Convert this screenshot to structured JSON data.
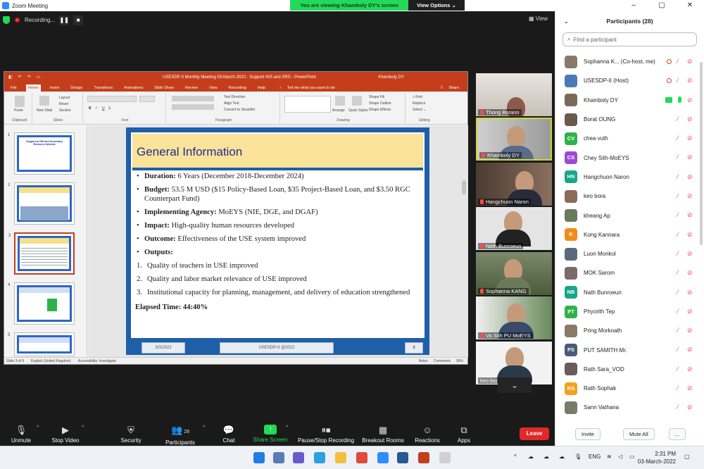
{
  "window": {
    "title": "Zoom Meeting",
    "viewing": "You are viewing Khamboly DY's screen",
    "view_options": "View Options",
    "recording": "Recording...",
    "view": "View"
  },
  "ppt": {
    "doc_title": "USESDP-II Monthly Meeting 03-March-2022 - Support NIS and SRS  -  PowerPoint",
    "user": "Khamboly DY",
    "tabs": [
      "File",
      "Home",
      "Insert",
      "Design",
      "Transitions",
      "Animations",
      "Slide Show",
      "Review",
      "View",
      "Recording",
      "Help"
    ],
    "tell_me": "Tell me what you want to do",
    "share": "Share",
    "ribbon": {
      "clipboard": "Clipboard",
      "paste": "Paste",
      "slides": "Slides",
      "new_slide": "New Slide",
      "layout": "Layout",
      "reset": "Reset",
      "section": "Section",
      "font": "Font",
      "paragraph": "Paragraph",
      "drawing": "Drawing",
      "editing": "Editing",
      "text_direction": "Text Direction",
      "align_text": "Align Text",
      "convert": "Convert to SmartArt",
      "arrange": "Arrange",
      "quick_styles": "Quick Styles",
      "shape_fill": "Shape Fill",
      "shape_outline": "Shape Outline",
      "shape_effects": "Shape Effects",
      "find": "Find",
      "replace": "Replace",
      "select": "Select"
    },
    "slide_numbers": [
      "1",
      "2",
      "3",
      "4",
      "5"
    ],
    "thumb1_title": "Support to NIS and Secondary Resource Schools",
    "slide": {
      "heading": "General Information",
      "duration_label": "Duration:",
      "duration_text": "6 Years (December 2018-December 2024)",
      "budget_label": "Budget:",
      "budget_text": "53.5 M USD ($15 Policy-Based Loan, $35 Project-Based Loan, and $3.50 RGC Counterpart Fund)",
      "agency_label": "Implementing Agency:",
      "agency_text": "MoEYS (NIE, DGE, and DGAF)",
      "impact_label": "Impact:",
      "impact_text": "High-quality human resources developed",
      "outcome_label": "Outcome:",
      "outcome_text": "Effectiveness of the USE system improved",
      "outputs_label": "Outputs:",
      "outputs": [
        {
          "n": "1.",
          "text": "Quality of teachers in USE improved"
        },
        {
          "n": "2.",
          "text": "Quality and labor market relevance of USE improved"
        },
        {
          "n": "3.",
          "text": "Institutional capacity for planning, management, and delivery of education strengthened"
        }
      ],
      "elapsed": "Elapsed Time: 44:40%",
      "footer_date": "3/3/2022",
      "footer_center": "USESDP-II @2022",
      "footer_page": "3"
    },
    "status": {
      "slide": "Slide 3 of 9",
      "language": "English (United Kingdom)",
      "accessibility": "Accessibility: Investigate",
      "notes": "Notes",
      "comments": "Comments",
      "zoom": "90%"
    }
  },
  "tiles": [
    {
      "name": "Thong Borann"
    },
    {
      "name": "Khamboly DY"
    },
    {
      "name": "Hangchuon Naron"
    },
    {
      "name": "Nath Bunroeun"
    },
    {
      "name": "Sophanna KANG"
    },
    {
      "name": "Va Sith PU MoEYS"
    },
    {
      "name": "keo bora"
    }
  ],
  "toolbar": {
    "unmute": "Unmute",
    "stop_video": "Stop Video",
    "security": "Security",
    "participants": "Participants",
    "participants_count": "28",
    "chat": "Chat",
    "share_screen": "Share Screen",
    "pause_recording": "Pause/Stop Recording",
    "breakout": "Breakout Rooms",
    "reactions": "Reactions",
    "apps": "Apps",
    "leave": "Leave"
  },
  "panel": {
    "title": "Participants (28)",
    "search_placeholder": "Find a participant",
    "invite": "Invite",
    "mute_all": "Mute All",
    "more": "...",
    "participants": [
      {
        "initials": "",
        "name": "Sophanna K...  (Co-host, me)",
        "color": "#8a7a6a"
      },
      {
        "initials": "",
        "name": "USESDP-II (Host)",
        "color": "#4a7ab8"
      },
      {
        "initials": "",
        "name": "Khamboly DY",
        "color": "#7a6a5a"
      },
      {
        "initials": "",
        "name": "Borat OUNG",
        "color": "#6a5a4a"
      },
      {
        "initials": "CV",
        "name": "chea vuth",
        "color": "#2fb24a"
      },
      {
        "initials": "CS",
        "name": "Chey Sith-MoEYS",
        "color": "#9b4bd1"
      },
      {
        "initials": "HN",
        "name": "Hangchuon Naron",
        "color": "#17a689"
      },
      {
        "initials": "",
        "name": "keo bora",
        "color": "#8a6a5a"
      },
      {
        "initials": "",
        "name": "kheang Ap",
        "color": "#6a7a5a"
      },
      {
        "initials": "K",
        "name": "Kong Kannara",
        "color": "#f28b1c"
      },
      {
        "initials": "",
        "name": "Luon Monkol",
        "color": "#5a6a7a"
      },
      {
        "initials": "",
        "name": "MOK Sarom",
        "color": "#7a6a6a"
      },
      {
        "initials": "NB",
        "name": "Nath Bunroeun",
        "color": "#17a689"
      },
      {
        "initials": "PT",
        "name": "Phyorith Tep",
        "color": "#2fb24a"
      },
      {
        "initials": "",
        "name": "Pring Morkoath",
        "color": "#8a7a6a"
      },
      {
        "initials": "PS",
        "name": "PUT SAMITH Mr.",
        "color": "#4a5a7a"
      },
      {
        "initials": "",
        "name": "Rath Sara_VOD",
        "color": "#6a5a5a"
      },
      {
        "initials": "RS",
        "name": "Rath Sophak",
        "color": "#f2a21c"
      },
      {
        "initials": "",
        "name": "Sann Vathana",
        "color": "#7a7a6a"
      }
    ]
  },
  "taskbar": {
    "lang": "ENG",
    "time": "2:31 PM",
    "date": "03-March-2022"
  }
}
